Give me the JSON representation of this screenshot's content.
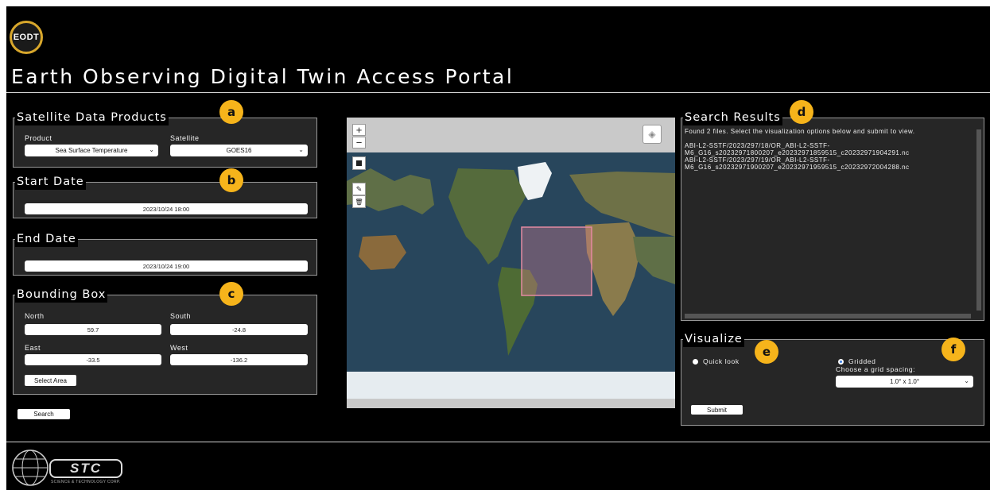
{
  "header": {
    "logo_text": "EODT",
    "title": "Earth Observing Digital Twin Access Portal"
  },
  "products_panel": {
    "legend": "Satellite Data Products",
    "product_label": "Product",
    "product_value": "Sea Surface Temperature",
    "satellite_label": "Satellite",
    "satellite_value": "GOES16"
  },
  "start_panel": {
    "legend": "Start Date",
    "value": "2023/10/24 18:00"
  },
  "end_panel": {
    "legend": "End Date",
    "value": "2023/10/24 19:00"
  },
  "bbox_panel": {
    "legend": "Bounding Box",
    "north_label": "North",
    "north_value": "59.7",
    "south_label": "South",
    "south_value": "-24.8",
    "east_label": "East",
    "east_value": "-33.5",
    "west_label": "West",
    "west_value": "-136.2",
    "select_area": "Select Area"
  },
  "search_button": "Search",
  "map": {
    "zoom_in": "+",
    "zoom_out": "−"
  },
  "results_panel": {
    "legend": "Search Results",
    "text": "Found 2 files. Select the visualization options below and submit to view.\n\nABI-L2-SSTF/2023/297/18/OR_ABI-L2-SSTF-\nM6_G16_s20232971800207_e20232971859515_c20232971904291.nc\nABI-L2-SSTF/2023/297/19/OR_ABI-L2-SSTF-\nM6_G16_s20232971900207_e20232971959515_c20232972004288.nc"
  },
  "visualize_panel": {
    "legend": "Visualize",
    "quick_look": "Quick look",
    "gridded": "Gridded",
    "grid_spacing_label": "Choose a grid spacing:",
    "grid_spacing_value": "1.0° x 1.0°",
    "submit": "Submit"
  },
  "badges": {
    "a": "a",
    "b": "b",
    "c": "c",
    "d": "d",
    "e": "e",
    "f": "f"
  },
  "footer": {
    "logo_text": "STC",
    "logo_subtext": "SCIENCE & TECHNOLOGY CORP."
  },
  "colors": {
    "badge": "#f6b41b",
    "panel": "#262626",
    "background": "#000000"
  }
}
